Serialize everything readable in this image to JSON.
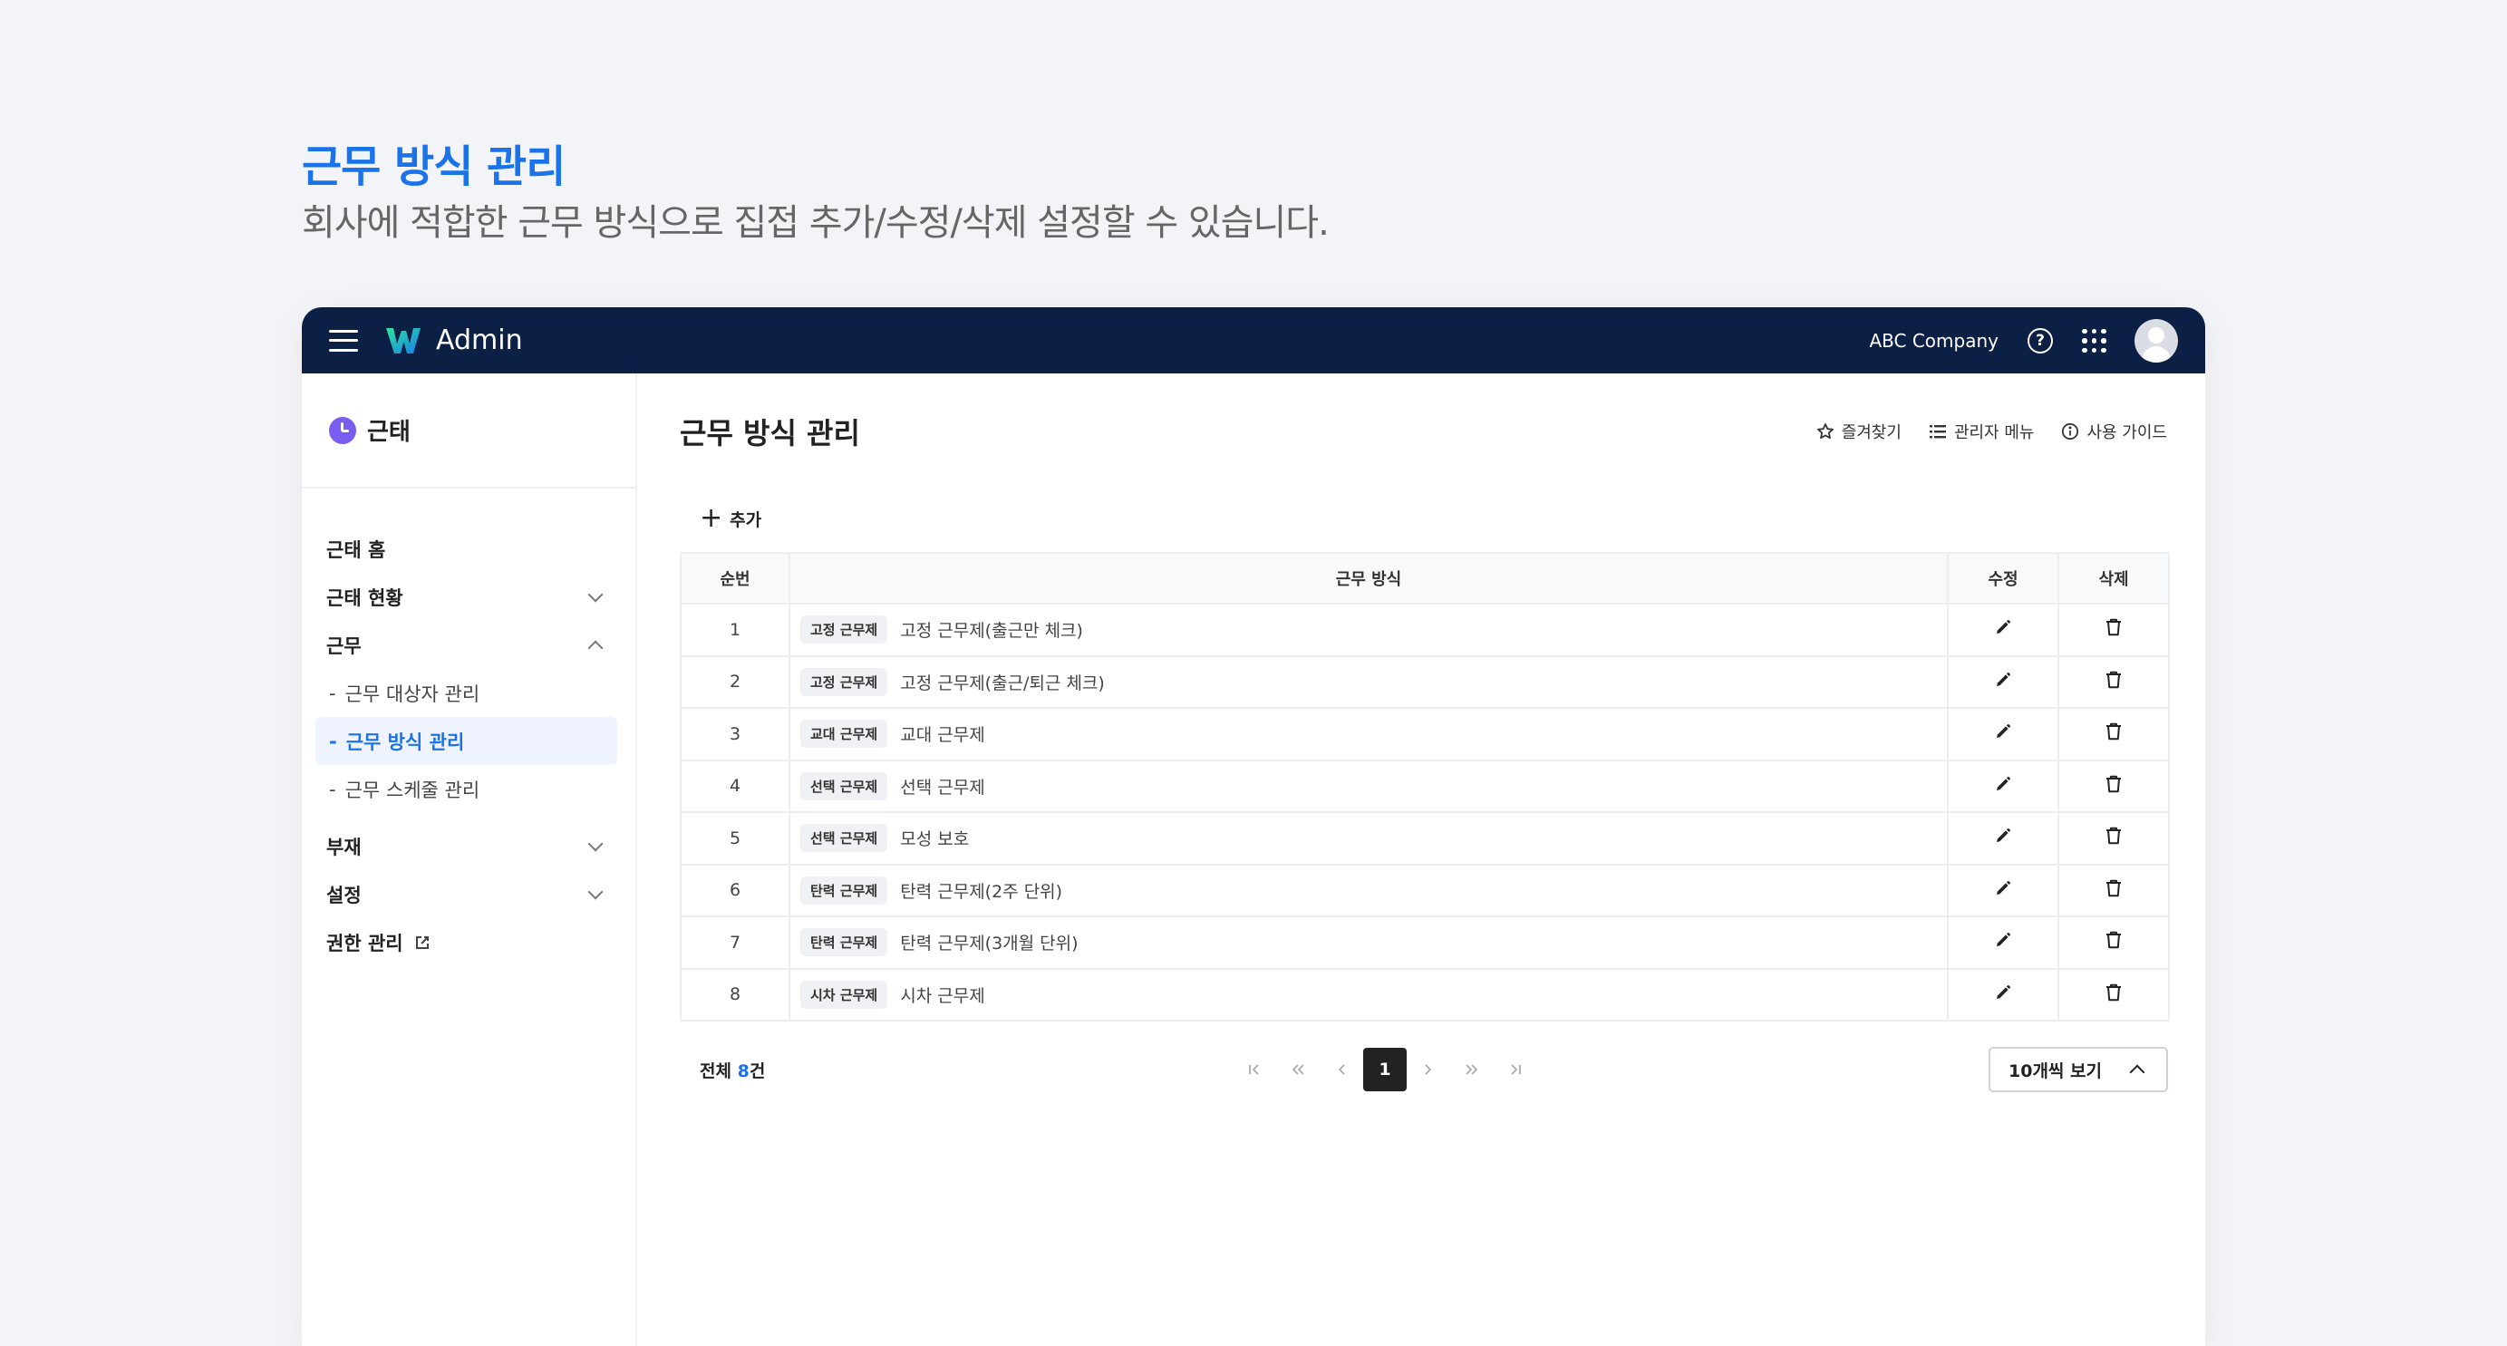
{
  "intro": {
    "title": "근무 방식 관리",
    "subtitle": "회사에 적합한 근무 방식으로 집접 추가/수정/삭제 설정할 수 있습니다."
  },
  "topbar": {
    "app_name": "Admin",
    "company": "ABC Company",
    "help_glyph": "?"
  },
  "sidebar": {
    "section_title": "근태",
    "items": [
      {
        "label": "근태 홈"
      },
      {
        "label": "근태 현황"
      },
      {
        "label": "근무"
      },
      {
        "label": "부재"
      },
      {
        "label": "설정"
      },
      {
        "label": "권한 관리"
      }
    ],
    "sub_items": [
      {
        "label": "근무 대상자 관리",
        "dash": "-"
      },
      {
        "label": "근무 방식 관리",
        "dash": "-"
      },
      {
        "label": "근무 스케줄 관리",
        "dash": "-"
      }
    ]
  },
  "main": {
    "title": "근무 방식 관리",
    "links": {
      "favorite": "즐겨찾기",
      "admin_menu": "관리자 메뉴",
      "guide": "사용 가이드"
    },
    "add_label": "추가",
    "add_glyph": "+",
    "table": {
      "headers": [
        "순번",
        "근무 방식",
        "수정",
        "삭제"
      ],
      "rows": [
        {
          "no": "1",
          "tag": "고정 근무제",
          "name": "고정 근무제(출근만 체크)"
        },
        {
          "no": "2",
          "tag": "고정 근무제",
          "name": "고정 근무제(출근/퇴근 체크)"
        },
        {
          "no": "3",
          "tag": "교대 근무제",
          "name": "교대 근무제"
        },
        {
          "no": "4",
          "tag": "선택 근무제",
          "name": "선택 근무제"
        },
        {
          "no": "5",
          "tag": "선택 근무제",
          "name": "모성 보호"
        },
        {
          "no": "6",
          "tag": "탄력 근무제",
          "name": "탄력 근무제(2주 단위)"
        },
        {
          "no": "7",
          "tag": "탄력 근무제",
          "name": "탄력 근무제(3개월 단위)"
        },
        {
          "no": "8",
          "tag": "시차 근무제",
          "name": "시차 근무제"
        }
      ]
    },
    "footer": {
      "total_prefix": "전체 ",
      "total_count": "8",
      "total_suffix": "건",
      "current_page": "1",
      "per_page": "10개씩 보기"
    }
  },
  "colors": {
    "accent": "#1a73e8",
    "topbar": "#0c1f45",
    "sidebar_icon": "#7b5cf0"
  },
  "icons": {
    "menu": "hamburger-icon",
    "logo": "w-logo-icon",
    "help": "help-circle-icon",
    "apps": "apps-grid-icon",
    "avatar": "user-avatar-icon",
    "edit": "pencil-icon",
    "delete": "trash-icon",
    "favorite": "star-icon",
    "admin_menu": "list-icon",
    "guide": "info-icon",
    "external": "external-link-icon"
  }
}
